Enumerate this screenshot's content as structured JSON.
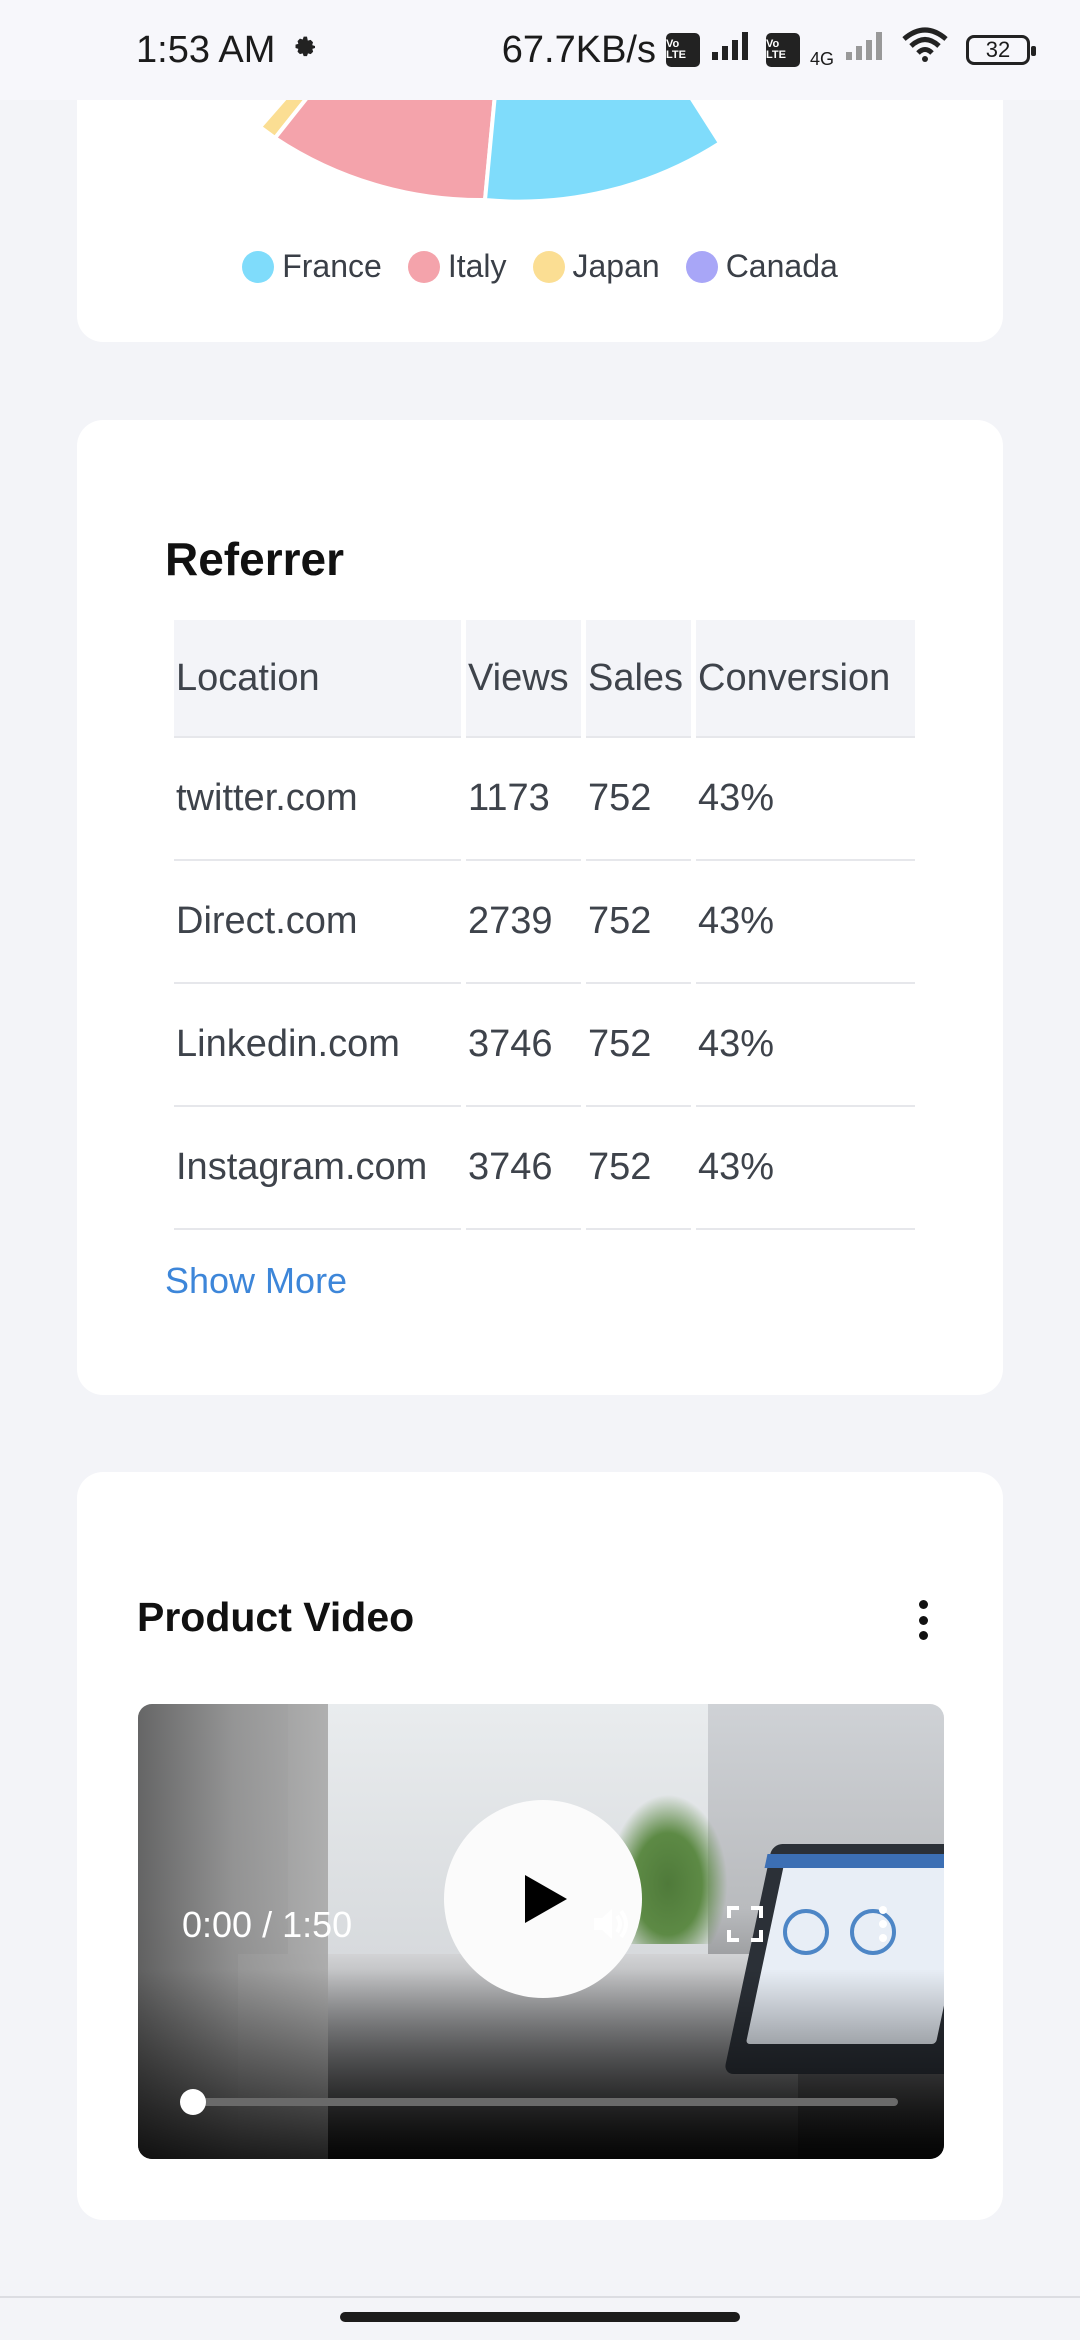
{
  "status_bar": {
    "time": "1:53 AM",
    "net_speed": "67.7KB/s",
    "volte_label": "Vo LTE",
    "network_type": "4G",
    "battery": "32",
    "icons": [
      "settings-gear-icon",
      "volte-icon",
      "signal-icon",
      "wifi-icon",
      "battery-icon"
    ]
  },
  "pie_card": {
    "legend": [
      {
        "label": "France",
        "color": "#7fdcfb"
      },
      {
        "label": "Italy",
        "color": "#f4a3ab"
      },
      {
        "label": "Japan",
        "color": "#fbde93"
      },
      {
        "label": "Canada",
        "color": "#a8a6f7"
      }
    ]
  },
  "chart_data": {
    "type": "pie",
    "categories": [
      "France",
      "Italy",
      "Japan",
      "Canada"
    ],
    "colors": [
      "#7fdcfb",
      "#f4a3ab",
      "#fbde93",
      "#a8a6f7"
    ],
    "legend_position": "bottom",
    "note_visible": "only the lower arc of the pie is visible (France and Italy slices, sliver of Japan)"
  },
  "referrer": {
    "title": "Referrer",
    "columns": [
      "Location",
      "Views",
      "Sales",
      "Conversion"
    ],
    "rows": [
      [
        "twitter.com",
        "1173",
        "752",
        "43%"
      ],
      [
        "Direct.com",
        "2739",
        "752",
        "43%"
      ],
      [
        "Linkedin.com",
        "3746",
        "752",
        "43%"
      ],
      [
        "Instagram.com",
        "3746",
        "752",
        "43%"
      ]
    ],
    "show_more": "Show More"
  },
  "product_video": {
    "title": "Product Video",
    "time": "0:00 / 1:50",
    "progress_fraction": 0,
    "icons": [
      "more-vertical-icon",
      "play-icon",
      "volume-icon",
      "fullscreen-icon",
      "more-vertical-icon"
    ]
  }
}
